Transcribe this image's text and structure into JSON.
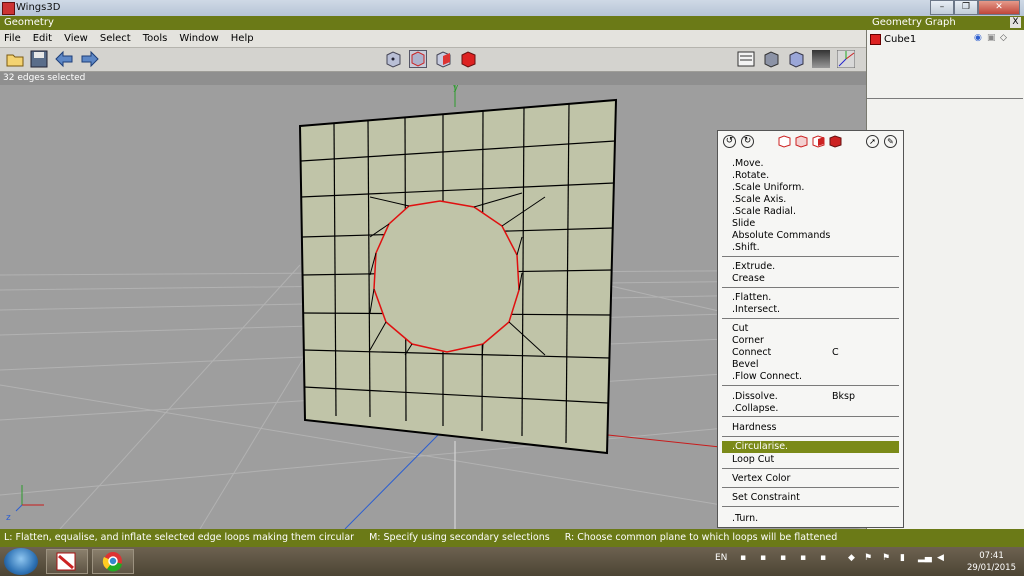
{
  "window": {
    "title": "Wings3D",
    "minimize": "–",
    "maximize": "❐",
    "close": "✕"
  },
  "geometry": {
    "header": "Geometry",
    "menu": [
      "File",
      "Edit",
      "View",
      "Select",
      "Tools",
      "Window",
      "Help"
    ],
    "status": "32 edges selected"
  },
  "graph": {
    "header": "Geometry Graph",
    "close": "X",
    "object_name": "Cube1"
  },
  "popup": {
    "items": [
      {
        "label": ".Move.",
        "shortcut": ""
      },
      {
        "label": ".Rotate.",
        "shortcut": ""
      },
      {
        "label": ".Scale Uniform.",
        "shortcut": ""
      },
      {
        "label": ".Scale Axis.",
        "shortcut": ""
      },
      {
        "label": ".Scale Radial.",
        "shortcut": ""
      },
      {
        "label": "Slide",
        "shortcut": ""
      },
      {
        "label": "Absolute Commands",
        "shortcut": ""
      },
      {
        "label": ".Shift.",
        "shortcut": ""
      },
      {
        "label": ".Extrude.",
        "shortcut": ""
      },
      {
        "label": "Crease",
        "shortcut": ""
      },
      {
        "label": ".Flatten.",
        "shortcut": ""
      },
      {
        "label": ".Intersect.",
        "shortcut": ""
      },
      {
        "label": "Cut",
        "shortcut": ""
      },
      {
        "label": "Corner",
        "shortcut": ""
      },
      {
        "label": "Connect",
        "shortcut": "C"
      },
      {
        "label": "Bevel",
        "shortcut": ""
      },
      {
        "label": ".Flow Connect.",
        "shortcut": ""
      },
      {
        "label": ".Dissolve.",
        "shortcut": "Bksp"
      },
      {
        "label": ".Collapse.",
        "shortcut": ""
      },
      {
        "label": "Hardness",
        "shortcut": ""
      },
      {
        "label": ".Circularise.",
        "shortcut": ""
      },
      {
        "label": "Loop Cut",
        "shortcut": ""
      },
      {
        "label": "Vertex Color",
        "shortcut": ""
      },
      {
        "label": "Set Constraint",
        "shortcut": ""
      },
      {
        "label": ".Turn.",
        "shortcut": ""
      }
    ],
    "highlighted": ".Circularise."
  },
  "hint": {
    "left": "L: Flatten, equalise, and inflate selected edge loops making them circular",
    "middle": "M: Specify using secondary selections",
    "right": "R: Choose common plane to which loops will be flattened"
  },
  "axis": {
    "y_label": "y",
    "z_label": "z"
  },
  "taskbar": {
    "lang": "EN",
    "time": "07:41",
    "date": "29/01/2015"
  },
  "colors": {
    "accent": "#6b7a17",
    "selected_edge": "#e01010",
    "face": "#c0c4a8"
  }
}
